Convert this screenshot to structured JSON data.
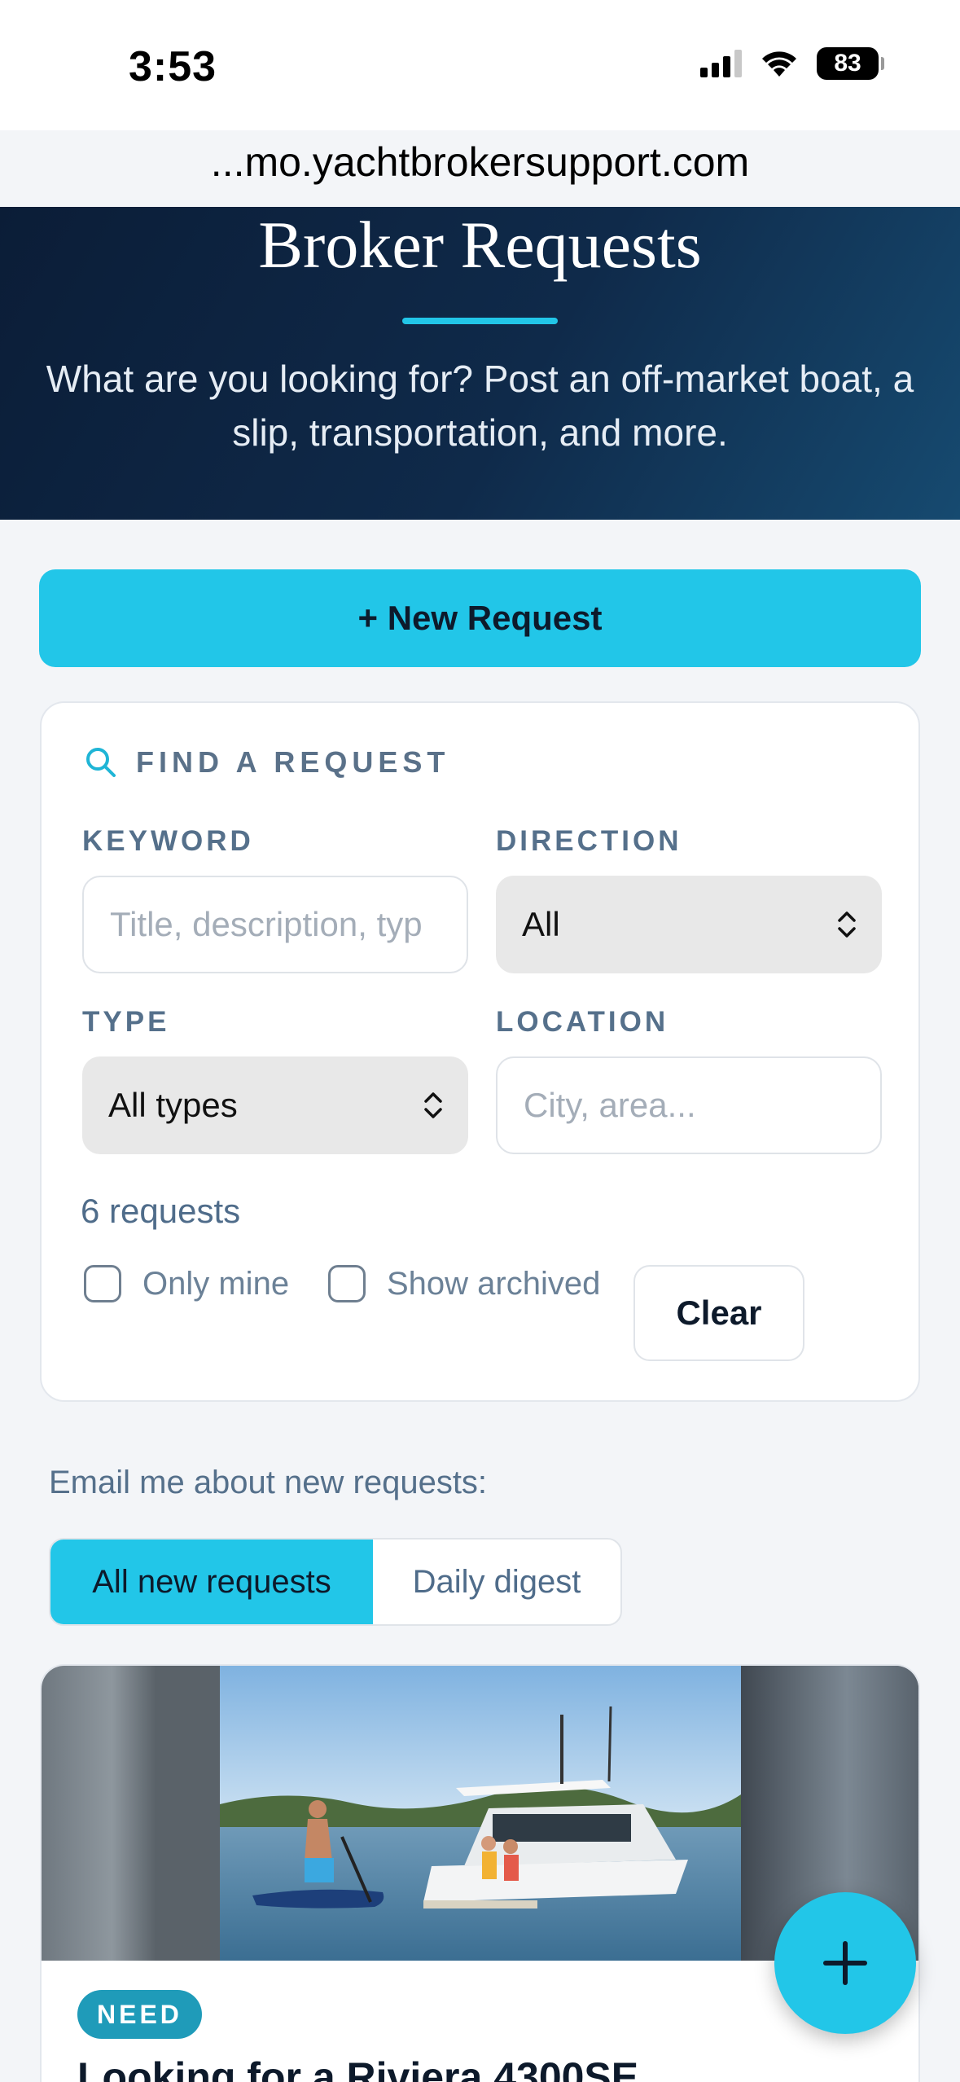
{
  "status_bar": {
    "time": "3:53",
    "battery": "83"
  },
  "browser": {
    "url": "...mo.yachtbrokersupport.com"
  },
  "hero": {
    "title": "Broker Requests",
    "subtitle": "What are you looking for? Post an off-market boat, a slip, transportation, and more."
  },
  "actions": {
    "new_request": "+ New Request"
  },
  "filters": {
    "heading": "FIND A REQUEST",
    "keyword": {
      "label": "KEYWORD",
      "placeholder": "Title, description, typ"
    },
    "direction": {
      "label": "DIRECTION",
      "value": "All"
    },
    "type": {
      "label": "TYPE",
      "value": "All types"
    },
    "location": {
      "label": "LOCATION",
      "placeholder": "City, area..."
    },
    "count": "6 requests",
    "only_mine": "Only mine",
    "show_archived": "Show archived",
    "clear": "Clear"
  },
  "email_prefs": {
    "label": "Email me about new requests:",
    "options": [
      "All new requests",
      "Daily digest"
    ],
    "selected": "All new requests"
  },
  "listing": {
    "badge": "NEED",
    "title": "Looking for a Riviera 4300SE"
  },
  "colors": {
    "accent": "#22c6e8",
    "hero_bg": "#0f2a4a",
    "muted_text": "#55708b"
  }
}
